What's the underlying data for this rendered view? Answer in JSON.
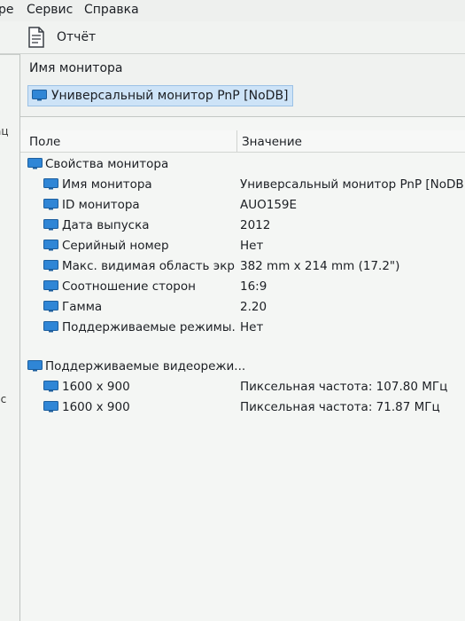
{
  "menu": {
    "items": [
      {
        "label": "ре"
      },
      {
        "label": "Сервис"
      },
      {
        "label": "Справка"
      }
    ]
  },
  "toolbar": {
    "report_label": "Отчёт",
    "report_icon": "document-icon"
  },
  "left_pane": {
    "clipped_texts": [
      "ац",
      "сс"
    ]
  },
  "device": {
    "header_label": "Имя монитора",
    "selected_name": "Универсальный монитор PnP [NoDB]",
    "icon": "monitor-icon"
  },
  "columns": {
    "field": "Поле",
    "value": "Значение"
  },
  "groups": [
    {
      "title": "Свойства монитора",
      "rows": [
        {
          "field": "Имя монитора",
          "value": "Универсальный монитор PnP [NoDB]"
        },
        {
          "field": "ID монитора",
          "value": "AUO159E"
        },
        {
          "field": "Дата выпуска",
          "value": "2012"
        },
        {
          "field": "Серийный номер",
          "value": "Нет"
        },
        {
          "field": "Макс. видимая область экр...",
          "value": "382 mm x 214 mm (17.2\")"
        },
        {
          "field": "Соотношение сторон",
          "value": "16:9"
        },
        {
          "field": "Гамма",
          "value": "2.20"
        },
        {
          "field": "Поддерживаемые режимы...",
          "value": "Нет"
        }
      ]
    },
    {
      "title": "Поддерживаемые видеорежи...",
      "rows": [
        {
          "field": "1600 x 900",
          "value": "Пиксельная частота: 107.80 МГц"
        },
        {
          "field": "1600 x 900",
          "value": "Пиксельная частота: 71.87 МГц"
        }
      ]
    }
  ],
  "colors": {
    "selection_bg": "#cde3f7",
    "monitor_screen": "#2f86d6",
    "monitor_frame": "#1d5f9e"
  }
}
